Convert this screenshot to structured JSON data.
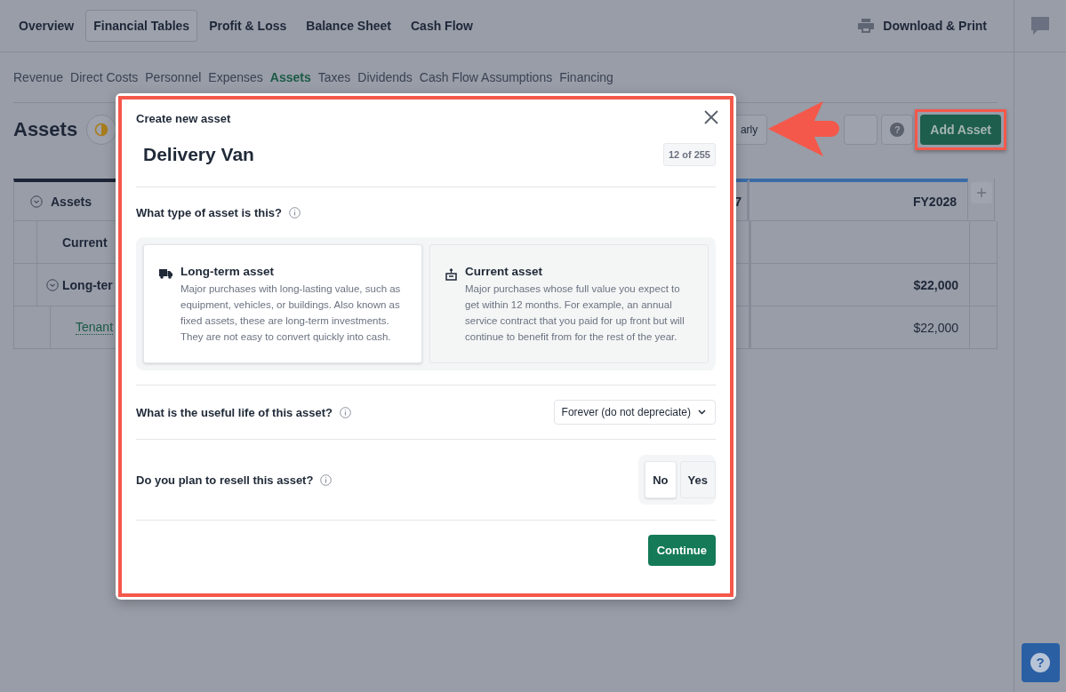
{
  "top_nav": {
    "tabs": [
      {
        "label": "Overview",
        "selected": false
      },
      {
        "label": "Financial Tables",
        "selected": true
      },
      {
        "label": "Profit & Loss",
        "selected": false
      },
      {
        "label": "Balance Sheet",
        "selected": false
      },
      {
        "label": "Cash Flow",
        "selected": false
      }
    ],
    "download": "Download & Print"
  },
  "sub_nav": [
    {
      "label": "Revenue",
      "selected": false
    },
    {
      "label": "Direct Costs",
      "selected": false
    },
    {
      "label": "Personnel",
      "selected": false
    },
    {
      "label": "Expenses",
      "selected": false
    },
    {
      "label": "Assets",
      "selected": true
    },
    {
      "label": "Taxes",
      "selected": false
    },
    {
      "label": "Dividends",
      "selected": false
    },
    {
      "label": "Cash Flow Assumptions",
      "selected": false
    },
    {
      "label": "Financing",
      "selected": false
    }
  ],
  "page": {
    "title": "Assets"
  },
  "toolbar": {
    "view_button": "arly",
    "help_label": "?",
    "add_button": "Add Asset"
  },
  "table": {
    "header": {
      "label": "Assets",
      "expanded": true
    },
    "columns": [
      "7",
      "FY2028"
    ],
    "rows": [
      {
        "label": "Current",
        "kind": "group"
      },
      {
        "label": "Long-ter",
        "kind": "group",
        "expanded": true,
        "fy2028": "$22,000",
        "children": [
          {
            "label": "Tenant",
            "kind": "link",
            "fy2028": "$22,000"
          }
        ]
      }
    ]
  },
  "dialog": {
    "title": "Create new asset",
    "name": {
      "value": "Delivery Van",
      "counter": "12 of 255"
    },
    "type_question": "What type of asset is this?",
    "options": [
      {
        "kind": "truck",
        "title": "Long-term asset",
        "description": "Major purchases with long-lasting value, such as equipment, vehicles, or buildings. Also known as fixed assets, these are long-term investments. They are not easy to convert quickly into cash.",
        "selected": true
      },
      {
        "kind": "box",
        "title": "Current asset",
        "description": "Major purchases whose full value you expect to get within 12 months. For example, an annual service contract that you paid for up front but will continue to benefit from for the rest of the year.",
        "selected": false
      }
    ],
    "life_question": "What is the useful life of this asset?",
    "life_select": "Forever (do not depreciate)",
    "resell_question": "Do you plan to resell this asset?",
    "resell_options": [
      {
        "label": "No",
        "selected": true
      },
      {
        "label": "Yes",
        "selected": false
      }
    ],
    "continue": "Continue"
  },
  "help_button": {
    "label": "?"
  }
}
